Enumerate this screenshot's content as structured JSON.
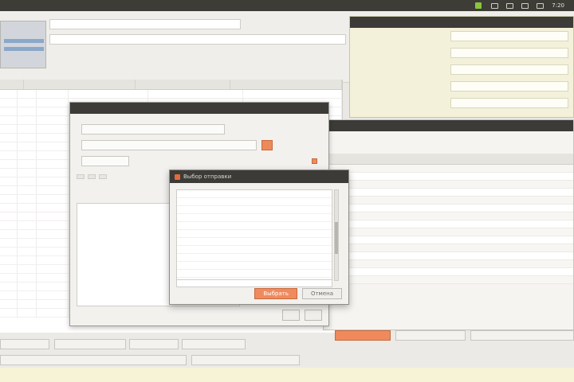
{
  "topbar": {
    "clock": "7:20"
  },
  "windows": {
    "selection_dialog": {
      "title": "Выбор отправки",
      "select_button": "Выбрать",
      "cancel_button": "Отмена"
    }
  },
  "colors": {
    "accent": "#f08a5d",
    "titlebar": "#3c3b37",
    "panel_yellow": "#f3f1da"
  }
}
